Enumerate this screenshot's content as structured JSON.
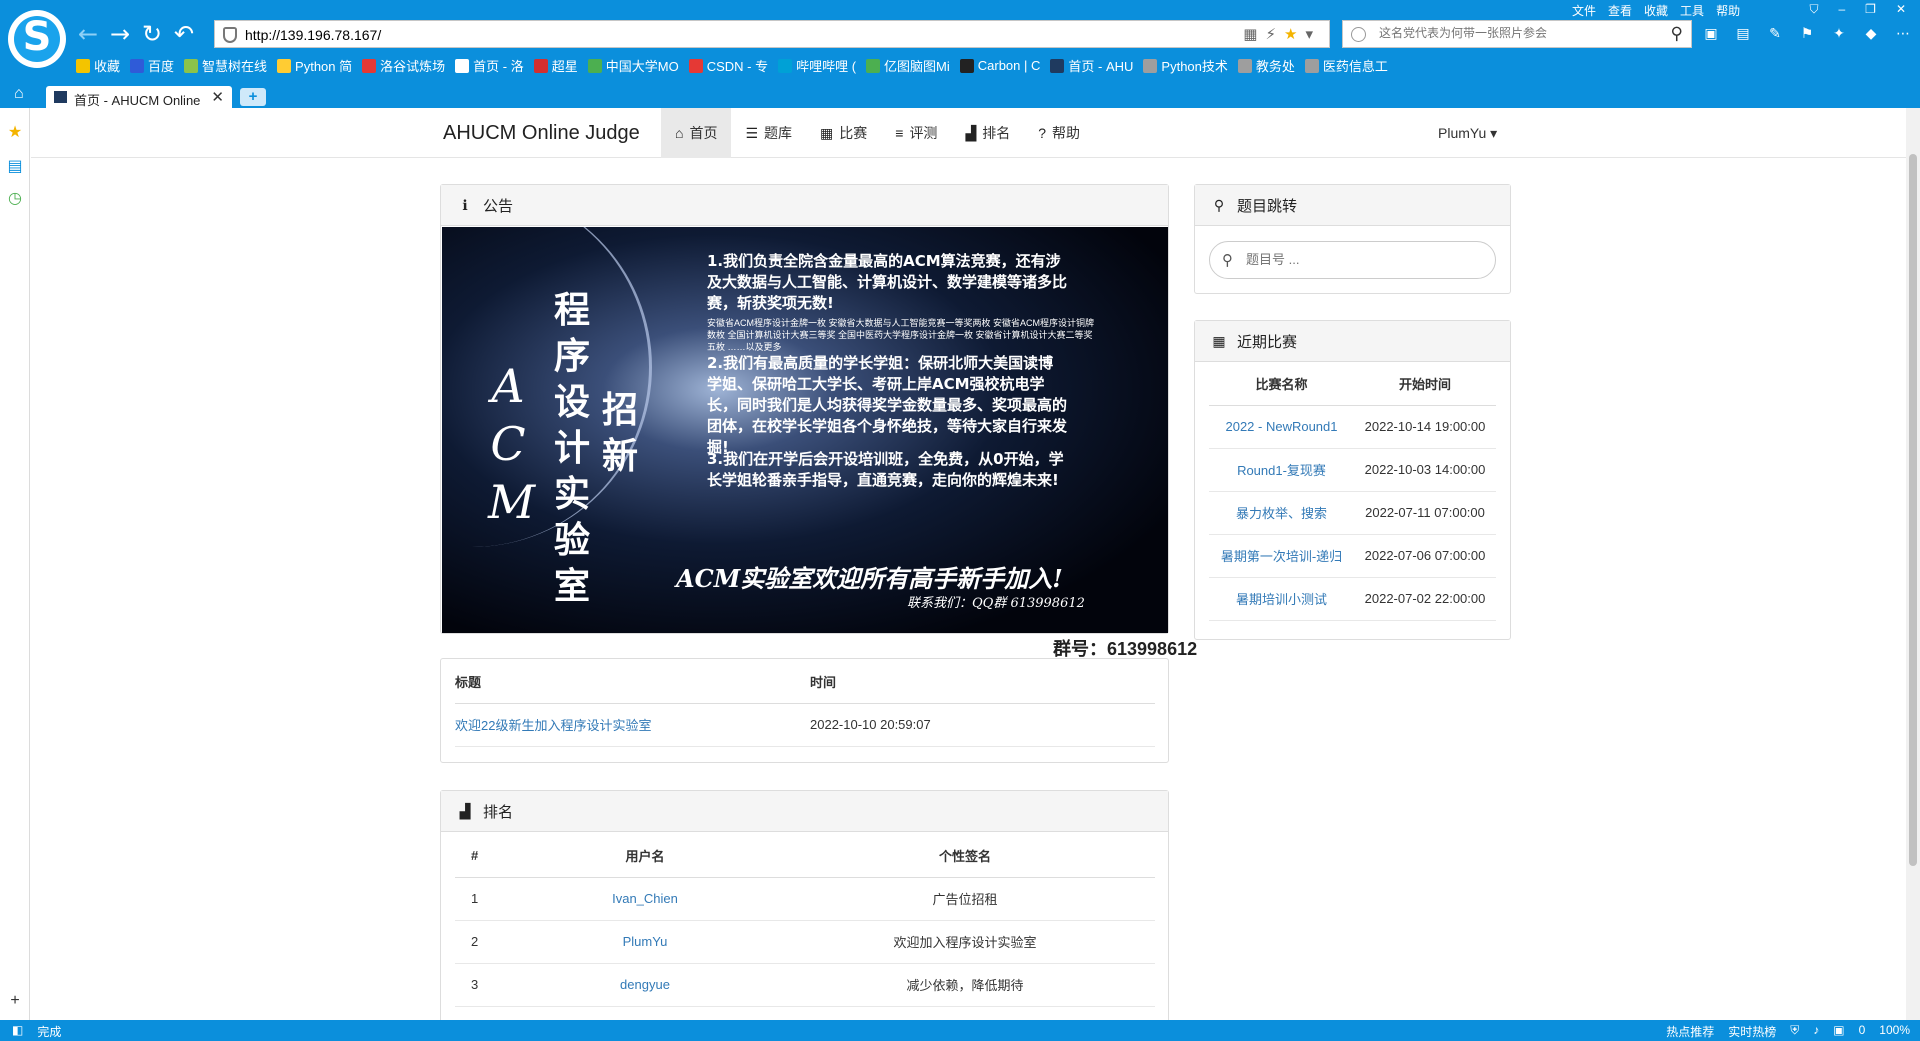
{
  "browser": {
    "menu": [
      "文件",
      "查看",
      "收藏",
      "工具",
      "帮助"
    ],
    "url": "http://139.196.78.167/",
    "search_placeholder": "这名党代表为何带一张照片参会",
    "bookmarks": [
      {
        "label": "收藏",
        "color": "#f4c400"
      },
      {
        "label": "百度",
        "color": "#2f5bd8"
      },
      {
        "label": "智慧树在线",
        "color": "#8bc34a"
      },
      {
        "label": "Python 简",
        "color": "#ffcc33"
      },
      {
        "label": "洛谷试炼场",
        "color": "#e53935"
      },
      {
        "label": "首页 - 洛",
        "color": "#ffffff"
      },
      {
        "label": "超星",
        "color": "#d32f2f"
      },
      {
        "label": "中国大学MO",
        "color": "#4caf50"
      },
      {
        "label": "CSDN - 专",
        "color": "#e53935"
      },
      {
        "label": "哔哩哔哩 (",
        "color": "#00a1d6"
      },
      {
        "label": "亿图脑图Mi",
        "color": "#4caf50"
      },
      {
        "label": "Carbon | C",
        "color": "#222222"
      },
      {
        "label": "首页 - AHU",
        "color": "#1f3a5f"
      },
      {
        "label": "Python技术",
        "color": "#9e9e9e"
      },
      {
        "label": "教务处",
        "color": "#9e9e9e"
      },
      {
        "label": "医药信息工",
        "color": "#9e9e9e"
      }
    ],
    "tab_title": "首页 - AHUCM Online",
    "status_left": "完成",
    "status_right": [
      "热点推荐",
      "实时热榜",
      "0",
      "100%"
    ]
  },
  "site": {
    "brand": "AHUCM Online Judge",
    "nav": [
      {
        "label": "首页",
        "icon": "home-icon",
        "glyph": "⌂",
        "active": true
      },
      {
        "label": "题库",
        "icon": "list-icon",
        "glyph": "☰",
        "active": false
      },
      {
        "label": "比赛",
        "icon": "calendar-icon",
        "glyph": "▦",
        "active": false
      },
      {
        "label": "评测",
        "icon": "tasks-icon",
        "glyph": "≡",
        "active": false
      },
      {
        "label": "排名",
        "icon": "signal-icon",
        "glyph": "▟",
        "active": false
      },
      {
        "label": "帮助",
        "icon": "question-icon",
        "glyph": "?",
        "active": false
      }
    ],
    "user": "PlumYu"
  },
  "announcement": {
    "title": "公告",
    "poster": {
      "acm": "ACM",
      "lab": "程序设计实验室",
      "recruit": "招新",
      "p1": "1.我们负责全院含金量最高的ACM算法竞赛，还有涉及大数据与人工智能、计算机设计、数学建模等诸多比赛，斩获奖项无数!",
      "small": "安徽省ACM程序设计金牌一枚  安徽省大数据与人工智能竞赛一等奖两枚  安徽省ACM程序设计铜牌数枚  全国计算机设计大赛三等奖  全国中医药大学程序设计金牌一枚  安徽省计算机设计大赛二等奖五枚 ……以及更多",
      "p2": "2.我们有最高质量的学长学姐：保研北师大美国读博学姐、保研哈工大学长、考研上岸ACM强校杭电学长，同时我们是人均获得奖学金数量最多、奖项最高的团体，在校学长学姐各个身怀绝技，等待大家自行来发掘!",
      "p3": "3.我们在开学后会开设培训班，全免费，从0开始，学长学姐轮番亲手指导，直通竞赛，走向你的辉煌未来!",
      "welcome": "ACM实验室欢迎所有高手新手加入!",
      "contact": "联系我们：QQ群 613998612"
    },
    "group": "群号：613998612"
  },
  "news": {
    "headers": [
      "标题",
      "时间"
    ],
    "rows": [
      {
        "title": "欢迎22级新生加入程序设计实验室",
        "time": "2022-10-10 20:59:07"
      }
    ]
  },
  "ranking": {
    "title": "排名",
    "headers": [
      "#",
      "用户名",
      "个性签名"
    ],
    "rows": [
      {
        "rank": "1",
        "user": "Ivan_Chien",
        "sign": "广告位招租"
      },
      {
        "rank": "2",
        "user": "PlumYu",
        "sign": "欢迎加入程序设计实验室"
      },
      {
        "rank": "3",
        "user": "dengyue",
        "sign": "减少依赖，降低期待"
      }
    ]
  },
  "jump": {
    "title": "题目跳转",
    "placeholder": "题目号 ..."
  },
  "recent": {
    "title": "近期比赛",
    "headers": [
      "比赛名称",
      "开始时间"
    ],
    "rows": [
      {
        "name": "2022 - NewRound1",
        "time": "2022-10-14 19:00:00"
      },
      {
        "name": "Round1-复现赛",
        "time": "2022-10-03 14:00:00"
      },
      {
        "name": "暴力枚举、搜索",
        "time": "2022-07-11 07:00:00"
      },
      {
        "name": "暑期第一次培训-递归",
        "time": "2022-07-06 07:00:00"
      },
      {
        "name": "暑期培训小测试",
        "time": "2022-07-02 22:00:00"
      }
    ]
  }
}
